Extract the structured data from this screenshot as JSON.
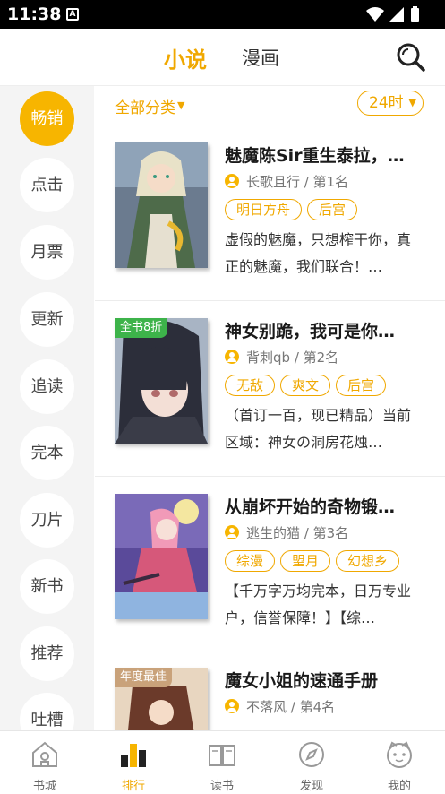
{
  "status_bar": {
    "time": "11:38",
    "notification_icon": "A"
  },
  "top_tabs": {
    "active": "小说",
    "inactive": "漫画"
  },
  "sidebar": {
    "items": [
      {
        "label": "畅销",
        "active": true
      },
      {
        "label": "点击"
      },
      {
        "label": "月票"
      },
      {
        "label": "更新"
      },
      {
        "label": "追读"
      },
      {
        "label": "完本"
      },
      {
        "label": "刀片"
      },
      {
        "label": "新书"
      },
      {
        "label": "推荐"
      },
      {
        "label": "吐槽"
      }
    ]
  },
  "filter": {
    "category_label": "全部分类",
    "time_label": "24时"
  },
  "books": [
    {
      "title": "魅魔陈Sir重生泰拉，…",
      "author": "长歌且行",
      "rank": "第1名",
      "tags": [
        "明日方舟",
        "后宫"
      ],
      "desc": "虚假的魅魔，只想榨干你，真正的魅魔，我们联合！…",
      "badge": ""
    },
    {
      "title": "神女别跪，我可是你…",
      "author": "背刺qb",
      "rank": "第2名",
      "tags": [
        "无敌",
        "爽文",
        "后宫"
      ],
      "desc": "（首订一百，现已精品）当前区域：神女の洞房花烛…",
      "badge": "全书8折"
    },
    {
      "title": "从崩坏开始的奇物锻…",
      "author": "逃生的猫",
      "rank": "第3名",
      "tags": [
        "综漫",
        "琞月",
        "幻想乡"
      ],
      "desc": "【千万字万均完本，日万专业户，信誉保障！】【综…",
      "badge": ""
    },
    {
      "title": "魔女小姐的速通手册",
      "author": "不落风",
      "rank": "第4名",
      "tags": [],
      "desc": "",
      "badge": "年度最佳"
    }
  ],
  "bottom_nav": [
    {
      "label": "书城",
      "icon": "house-icon"
    },
    {
      "label": "排行",
      "icon": "ranking-bars-icon",
      "active": true
    },
    {
      "label": "读书",
      "icon": "open-book-icon"
    },
    {
      "label": "发现",
      "icon": "compass-icon"
    },
    {
      "label": "我的",
      "icon": "cat-face-icon"
    }
  ],
  "colors": {
    "accent": "#f7b500",
    "accent_text": "#f0a800",
    "sidebar_bg": "#f4f4f4",
    "badge_green": "#3db34a",
    "badge_brown": "#c9a27a"
  }
}
